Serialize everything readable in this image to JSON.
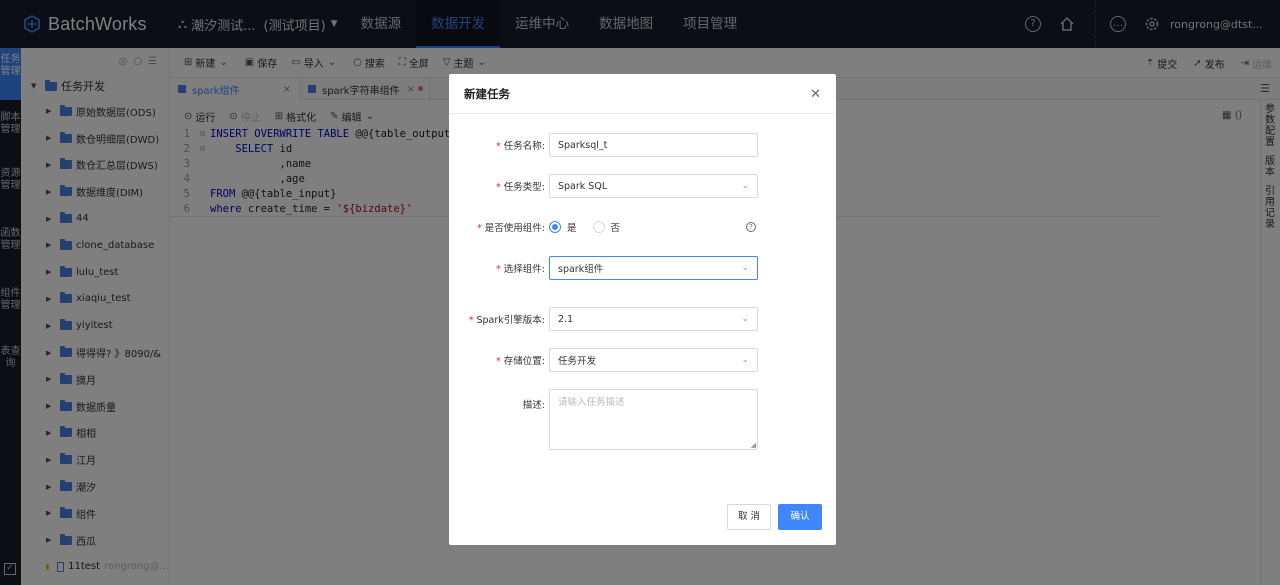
{
  "app": {
    "title": "BatchWorks"
  },
  "nav": {
    "project_label": "潮汐测试...",
    "project_suffix": "(测试项目)",
    "tabs": [
      "数据源",
      "数据开发",
      "运维中心",
      "数据地图",
      "项目管理"
    ],
    "active_tab": "数据开发",
    "user": "rongrong@dtst..."
  },
  "vmenu": {
    "items": [
      "任务管理",
      "脚本管理",
      "资源管理",
      "函数管理",
      "组件管理",
      "表查询"
    ]
  },
  "tree": {
    "root": "任务开发",
    "folders": [
      "原始数据层(ODS)",
      "数仓明细层(DWD)",
      "数仓汇总层(DWS)",
      "数据维度(DIM)",
      "44",
      "clone_database",
      "lulu_test",
      "xiaqiu_test",
      "yiyitest",
      "得得得? 》8090/&",
      "摘月",
      "数据质量",
      "相相",
      "江月",
      "潮汐",
      "组件",
      "西瓜"
    ],
    "task": "11test",
    "task_owner": "rongrong@..."
  },
  "toolbar": {
    "new": "新建",
    "save": "保存",
    "import": "导入",
    "search": "搜索",
    "fullscreen": "全屏",
    "theme": "主题",
    "submit": "提交",
    "publish": "发布",
    "ops": "运维"
  },
  "tabs": [
    {
      "label": "spark组件",
      "active": true
    },
    {
      "label": "spark字符串组件",
      "active": false
    }
  ],
  "editor_actions": {
    "run": "运行",
    "stop": "停止",
    "format": "格式化",
    "edit": "编辑"
  },
  "code": {
    "line_numbers": [
      "1",
      "2",
      "3",
      "4",
      "5",
      "6"
    ],
    "l1_kw": "INSERT OVERWRITE TABLE",
    "l1_rest": " @@{table_output}",
    "l2_kw": "    SELECT",
    "l2_rest": " id",
    "l3": "           ,name",
    "l4": "           ,age",
    "l5_kw": "FROM",
    "l5_rest": " @@{table_input}",
    "l6_kw": "where",
    "l6_mid": " create_time = ",
    "l6_str": "'${bizdate}'"
  },
  "right_panel": {
    "items": [
      "参数配置",
      "版本",
      "引用记录"
    ]
  },
  "modal": {
    "title": "新建任务",
    "fields": {
      "name_label": "任务名称",
      "name_value": "Sparksql_t",
      "type_label": "任务类型",
      "type_value": "Spark SQL",
      "use_component_label": "是否使用组件",
      "yes": "是",
      "no": "否",
      "component_label": "选择组件",
      "component_value": "spark组件",
      "engine_label": "Spark引擎版本",
      "engine_value": "2.1",
      "location_label": "存储位置",
      "location_value": "任务开发",
      "desc_label": "描述",
      "desc_placeholder": "请输入任务描述"
    },
    "cancel": "取 消",
    "ok": "确认"
  },
  "colors": {
    "accent": "#3f87ff",
    "nav_bg": "#1a1d2b",
    "required": "#f5222d"
  }
}
